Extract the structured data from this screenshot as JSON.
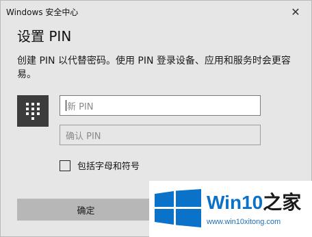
{
  "window": {
    "title": "Windows 安全中心",
    "close_glyph": "✕"
  },
  "dialog": {
    "heading": "设置 PIN",
    "description": "创建 PIN 以代替密码。使用 PIN 登录设备、应用和服务时会更容易。"
  },
  "form": {
    "new_pin_placeholder": "新 PIN",
    "confirm_pin_placeholder": "确认 PIN",
    "include_letters_label": "包括字母和符号",
    "include_letters_checked": false
  },
  "buttons": {
    "ok_label": "确定"
  },
  "watermark": {
    "brand": "Win10",
    "brand_zh": "之家",
    "url": "www.win10xitong.com"
  },
  "colors": {
    "accent_blue": "#0a72c8",
    "pin_icon_bg": "#3c3c3c",
    "button_bg": "#b7b7b7"
  },
  "icons": {
    "pin_icon": "keypad-icon",
    "close_icon": "close-icon",
    "logo_icon": "windows-logo-icon"
  }
}
